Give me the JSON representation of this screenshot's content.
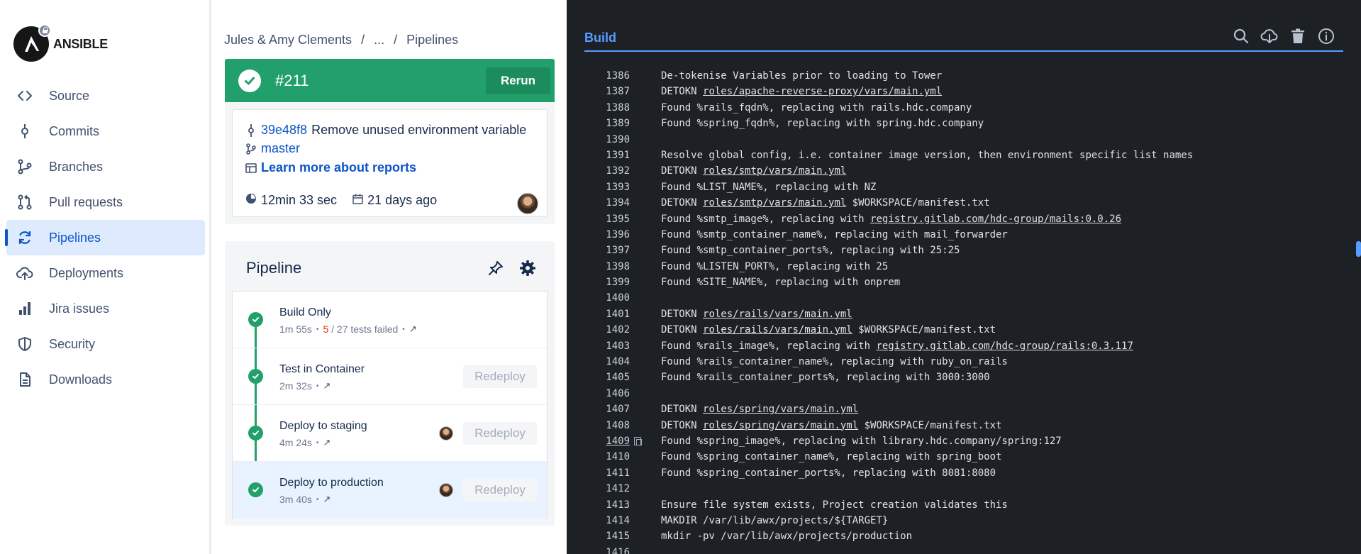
{
  "brand": {
    "name": "ANSIBLE"
  },
  "sidebar": {
    "items": [
      {
        "label": "Source",
        "icon": "code-icon",
        "active": false
      },
      {
        "label": "Commits",
        "icon": "commit-icon",
        "active": false
      },
      {
        "label": "Branches",
        "icon": "branch-icon",
        "active": false
      },
      {
        "label": "Pull requests",
        "icon": "pull-request-icon",
        "active": false
      },
      {
        "label": "Pipelines",
        "icon": "pipelines-icon",
        "active": true
      },
      {
        "label": "Deployments",
        "icon": "cloud-upload-icon",
        "active": false
      },
      {
        "label": "Jira issues",
        "icon": "jira-icon",
        "active": false
      },
      {
        "label": "Security",
        "icon": "shield-icon",
        "active": false
      },
      {
        "label": "Downloads",
        "icon": "file-icon",
        "active": false
      }
    ]
  },
  "breadcrumb": {
    "workspace": "Jules & Amy Clements",
    "ellipsis": "...",
    "current": "Pipelines"
  },
  "build": {
    "number": "#211",
    "rerun_label": "Rerun",
    "commit_hash": "39e48f8",
    "commit_message": "Remove unused environment variable",
    "branch": "master",
    "reports_link": "Learn more about reports",
    "duration": "12min 33 sec",
    "age": "21 days ago",
    "status_color": "#22a06b"
  },
  "pipeline": {
    "title": "Pipeline",
    "stages": [
      {
        "name": "Build Only",
        "duration": "1m 55s",
        "failed_tests": "5",
        "total_tests": "/ 27 tests failed",
        "has_avatar": false,
        "redeploy": ""
      },
      {
        "name": "Test in Container",
        "duration": "2m 32s",
        "has_avatar": false,
        "redeploy": "Redeploy"
      },
      {
        "name": "Deploy to staging",
        "duration": "4m 24s",
        "has_avatar": true,
        "redeploy": "Redeploy"
      },
      {
        "name": "Deploy to production",
        "duration": "3m 40s",
        "has_avatar": true,
        "redeploy": "Redeploy"
      }
    ]
  },
  "log": {
    "tab_label": "Build",
    "accent": "#579dff",
    "lines": [
      {
        "n": "1386",
        "parts": [
          [
            "t",
            "De-tokenise Variables prior to loading to Tower"
          ]
        ]
      },
      {
        "n": "1387",
        "parts": [
          [
            "t",
            "DETOKN "
          ],
          [
            "u",
            "roles/apache-reverse-proxy/vars/main.yml"
          ]
        ]
      },
      {
        "n": "1388",
        "parts": [
          [
            "t",
            "Found %rails_fqdn%, replacing with rails.hdc.company"
          ]
        ]
      },
      {
        "n": "1389",
        "parts": [
          [
            "t",
            "Found %spring_fqdn%, replacing with spring.hdc.company"
          ]
        ]
      },
      {
        "n": "1390",
        "parts": []
      },
      {
        "n": "1391",
        "parts": [
          [
            "t",
            "Resolve global config, i.e. container image version, then environment specific list names"
          ]
        ]
      },
      {
        "n": "1392",
        "parts": [
          [
            "t",
            "DETOKN "
          ],
          [
            "u",
            "roles/smtp/vars/main.yml"
          ]
        ]
      },
      {
        "n": "1393",
        "parts": [
          [
            "t",
            "Found %LIST_NAME%, replacing with NZ"
          ]
        ]
      },
      {
        "n": "1394",
        "parts": [
          [
            "t",
            "DETOKN "
          ],
          [
            "u",
            "roles/smtp/vars/main.yml"
          ],
          [
            "t",
            " $WORKSPACE/manifest.txt"
          ]
        ]
      },
      {
        "n": "1395",
        "parts": [
          [
            "t",
            "Found %smtp_image%, replacing with "
          ],
          [
            "u",
            "registry.gitlab.com/hdc-group/mails:0.0.26"
          ]
        ]
      },
      {
        "n": "1396",
        "parts": [
          [
            "t",
            "Found %smtp_container_name%, replacing with mail_forwarder"
          ]
        ]
      },
      {
        "n": "1397",
        "parts": [
          [
            "t",
            "Found %smtp_container_ports%, replacing with 25:25"
          ]
        ]
      },
      {
        "n": "1398",
        "parts": [
          [
            "t",
            "Found %LISTEN_PORT%, replacing with 25"
          ]
        ]
      },
      {
        "n": "1399",
        "parts": [
          [
            "t",
            "Found %SITE_NAME%, replacing with onprem"
          ]
        ]
      },
      {
        "n": "1400",
        "parts": []
      },
      {
        "n": "1401",
        "parts": [
          [
            "t",
            "DETOKN "
          ],
          [
            "u",
            "roles/rails/vars/main.yml"
          ]
        ]
      },
      {
        "n": "1402",
        "parts": [
          [
            "t",
            "DETOKN "
          ],
          [
            "u",
            "roles/rails/vars/main.yml"
          ],
          [
            "t",
            " $WORKSPACE/manifest.txt"
          ]
        ]
      },
      {
        "n": "1403",
        "parts": [
          [
            "t",
            "Found %rails_image%, replacing with "
          ],
          [
            "u",
            "registry.gitlab.com/hdc-group/rails:0.3.117"
          ]
        ]
      },
      {
        "n": "1404",
        "parts": [
          [
            "t",
            "Found %rails_container_name%, replacing with ruby_on_rails"
          ]
        ]
      },
      {
        "n": "1405",
        "parts": [
          [
            "t",
            "Found %rails_container_ports%, replacing with 3000:3000"
          ]
        ]
      },
      {
        "n": "1406",
        "parts": []
      },
      {
        "n": "1407",
        "parts": [
          [
            "t",
            "DETOKN "
          ],
          [
            "u",
            "roles/spring/vars/main.yml"
          ]
        ]
      },
      {
        "n": "1408",
        "parts": [
          [
            "t",
            "DETOKN "
          ],
          [
            "u",
            "roles/spring/vars/main.yml"
          ],
          [
            "t",
            " $WORKSPACE/manifest.txt"
          ]
        ]
      },
      {
        "n": "1409",
        "focus": true,
        "parts": [
          [
            "t",
            "Found %spring_image%, replacing with library.hdc.company/spring:127"
          ]
        ]
      },
      {
        "n": "1410",
        "parts": [
          [
            "t",
            "Found %spring_container_name%, replacing with spring_boot"
          ]
        ]
      },
      {
        "n": "1411",
        "parts": [
          [
            "t",
            "Found %spring_container_ports%, replacing with 8081:8080"
          ]
        ]
      },
      {
        "n": "1412",
        "parts": []
      },
      {
        "n": "1413",
        "parts": [
          [
            "t",
            "Ensure file system exists, Project creation validates this"
          ]
        ]
      },
      {
        "n": "1414",
        "parts": [
          [
            "t",
            "MAKDIR /var/lib/awx/projects/${TARGET}"
          ]
        ]
      },
      {
        "n": "1415",
        "parts": [
          [
            "t",
            "mkdir -pv /var/lib/awx/projects/production"
          ]
        ]
      },
      {
        "n": "1416",
        "parts": []
      }
    ]
  }
}
